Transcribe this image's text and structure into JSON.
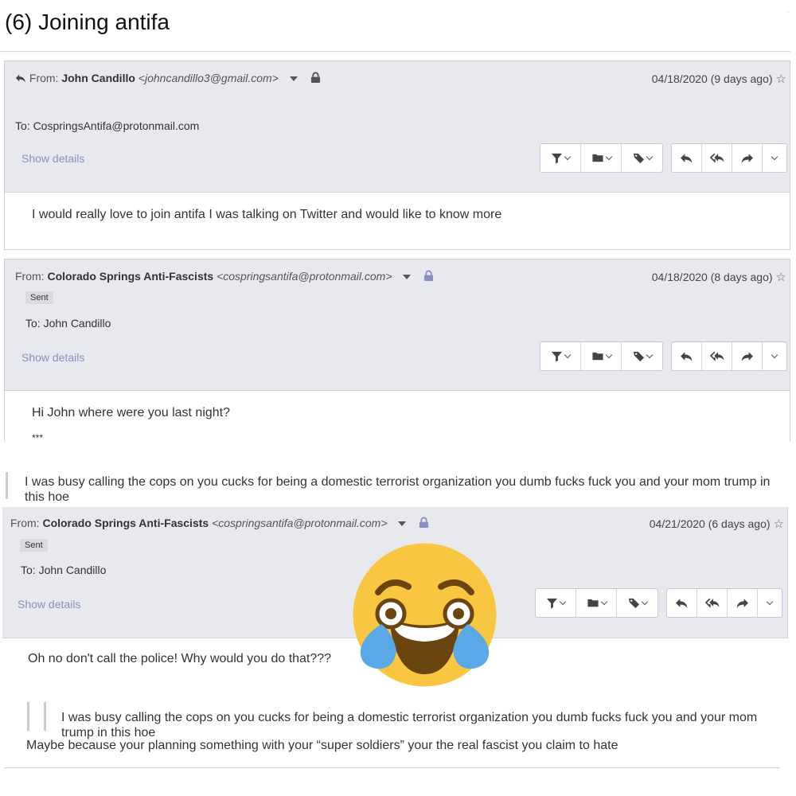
{
  "page": {
    "title": "(6) Joining antifa",
    "corner_mark": "˙"
  },
  "messages": [
    {
      "from_label": "From:",
      "sender_name": "John Candillo",
      "sender_email": "<johncandillo3@gmail.com>",
      "date": "04/18/2020 (9 days ago)",
      "to": "To: CospringsAntifa@protonmail.com",
      "details": "Show details",
      "body": "I would really love to join antifa I was talking on Twitter and would like to know more"
    },
    {
      "from_label": "From:",
      "sender_name": "Colorado Springs Anti-Fascists",
      "sender_email": "<cospringsantifa@protonmail.com>",
      "date": "04/18/2020 (8 days ago)",
      "badge": "Sent",
      "to": "To: John Candillo",
      "details": "Show details",
      "body": "Hi John where were you last night?",
      "separator": "***"
    },
    {
      "from_label": "From:",
      "sender_name": "Colorado Springs Anti-Fascists",
      "sender_email": "<cospringsantifa@protonmail.com>",
      "date": "04/21/2020 (6 days ago)",
      "badge": "Sent",
      "to": "To: John Candillo",
      "details": "Show details",
      "body": "Oh no don't call the police! Why would you do that???",
      "quoted": "I was busy calling the cops on you cucks for being a domestic terrorist organization you dumb fucks fuck you and your mom trump in this hoe",
      "reply": "Maybe because your planning something with your “super soldiers” your the real fascist you claim to hate"
    }
  ],
  "reply_quote": "I was busy calling the cops on you cucks for being a domestic terrorist organization you dumb fucks fuck you and your mom trump in this hoe",
  "icons": {
    "reply": "reply-icon",
    "reply_all": "reply-all-icon",
    "forward": "forward-icon",
    "filter": "filter-icon",
    "folder": "folder-icon",
    "label": "tag-icon",
    "lock": "lock-icon",
    "star": "star-icon",
    "emoji": "laughing-crying-emoji"
  },
  "colors": {
    "header_bg": "#e8e9ef",
    "link": "#8a8fc3",
    "lock_purple": "#8a8fc3",
    "emoji_yellow": "#f8c640",
    "tear_blue": "#5aa9e6"
  }
}
